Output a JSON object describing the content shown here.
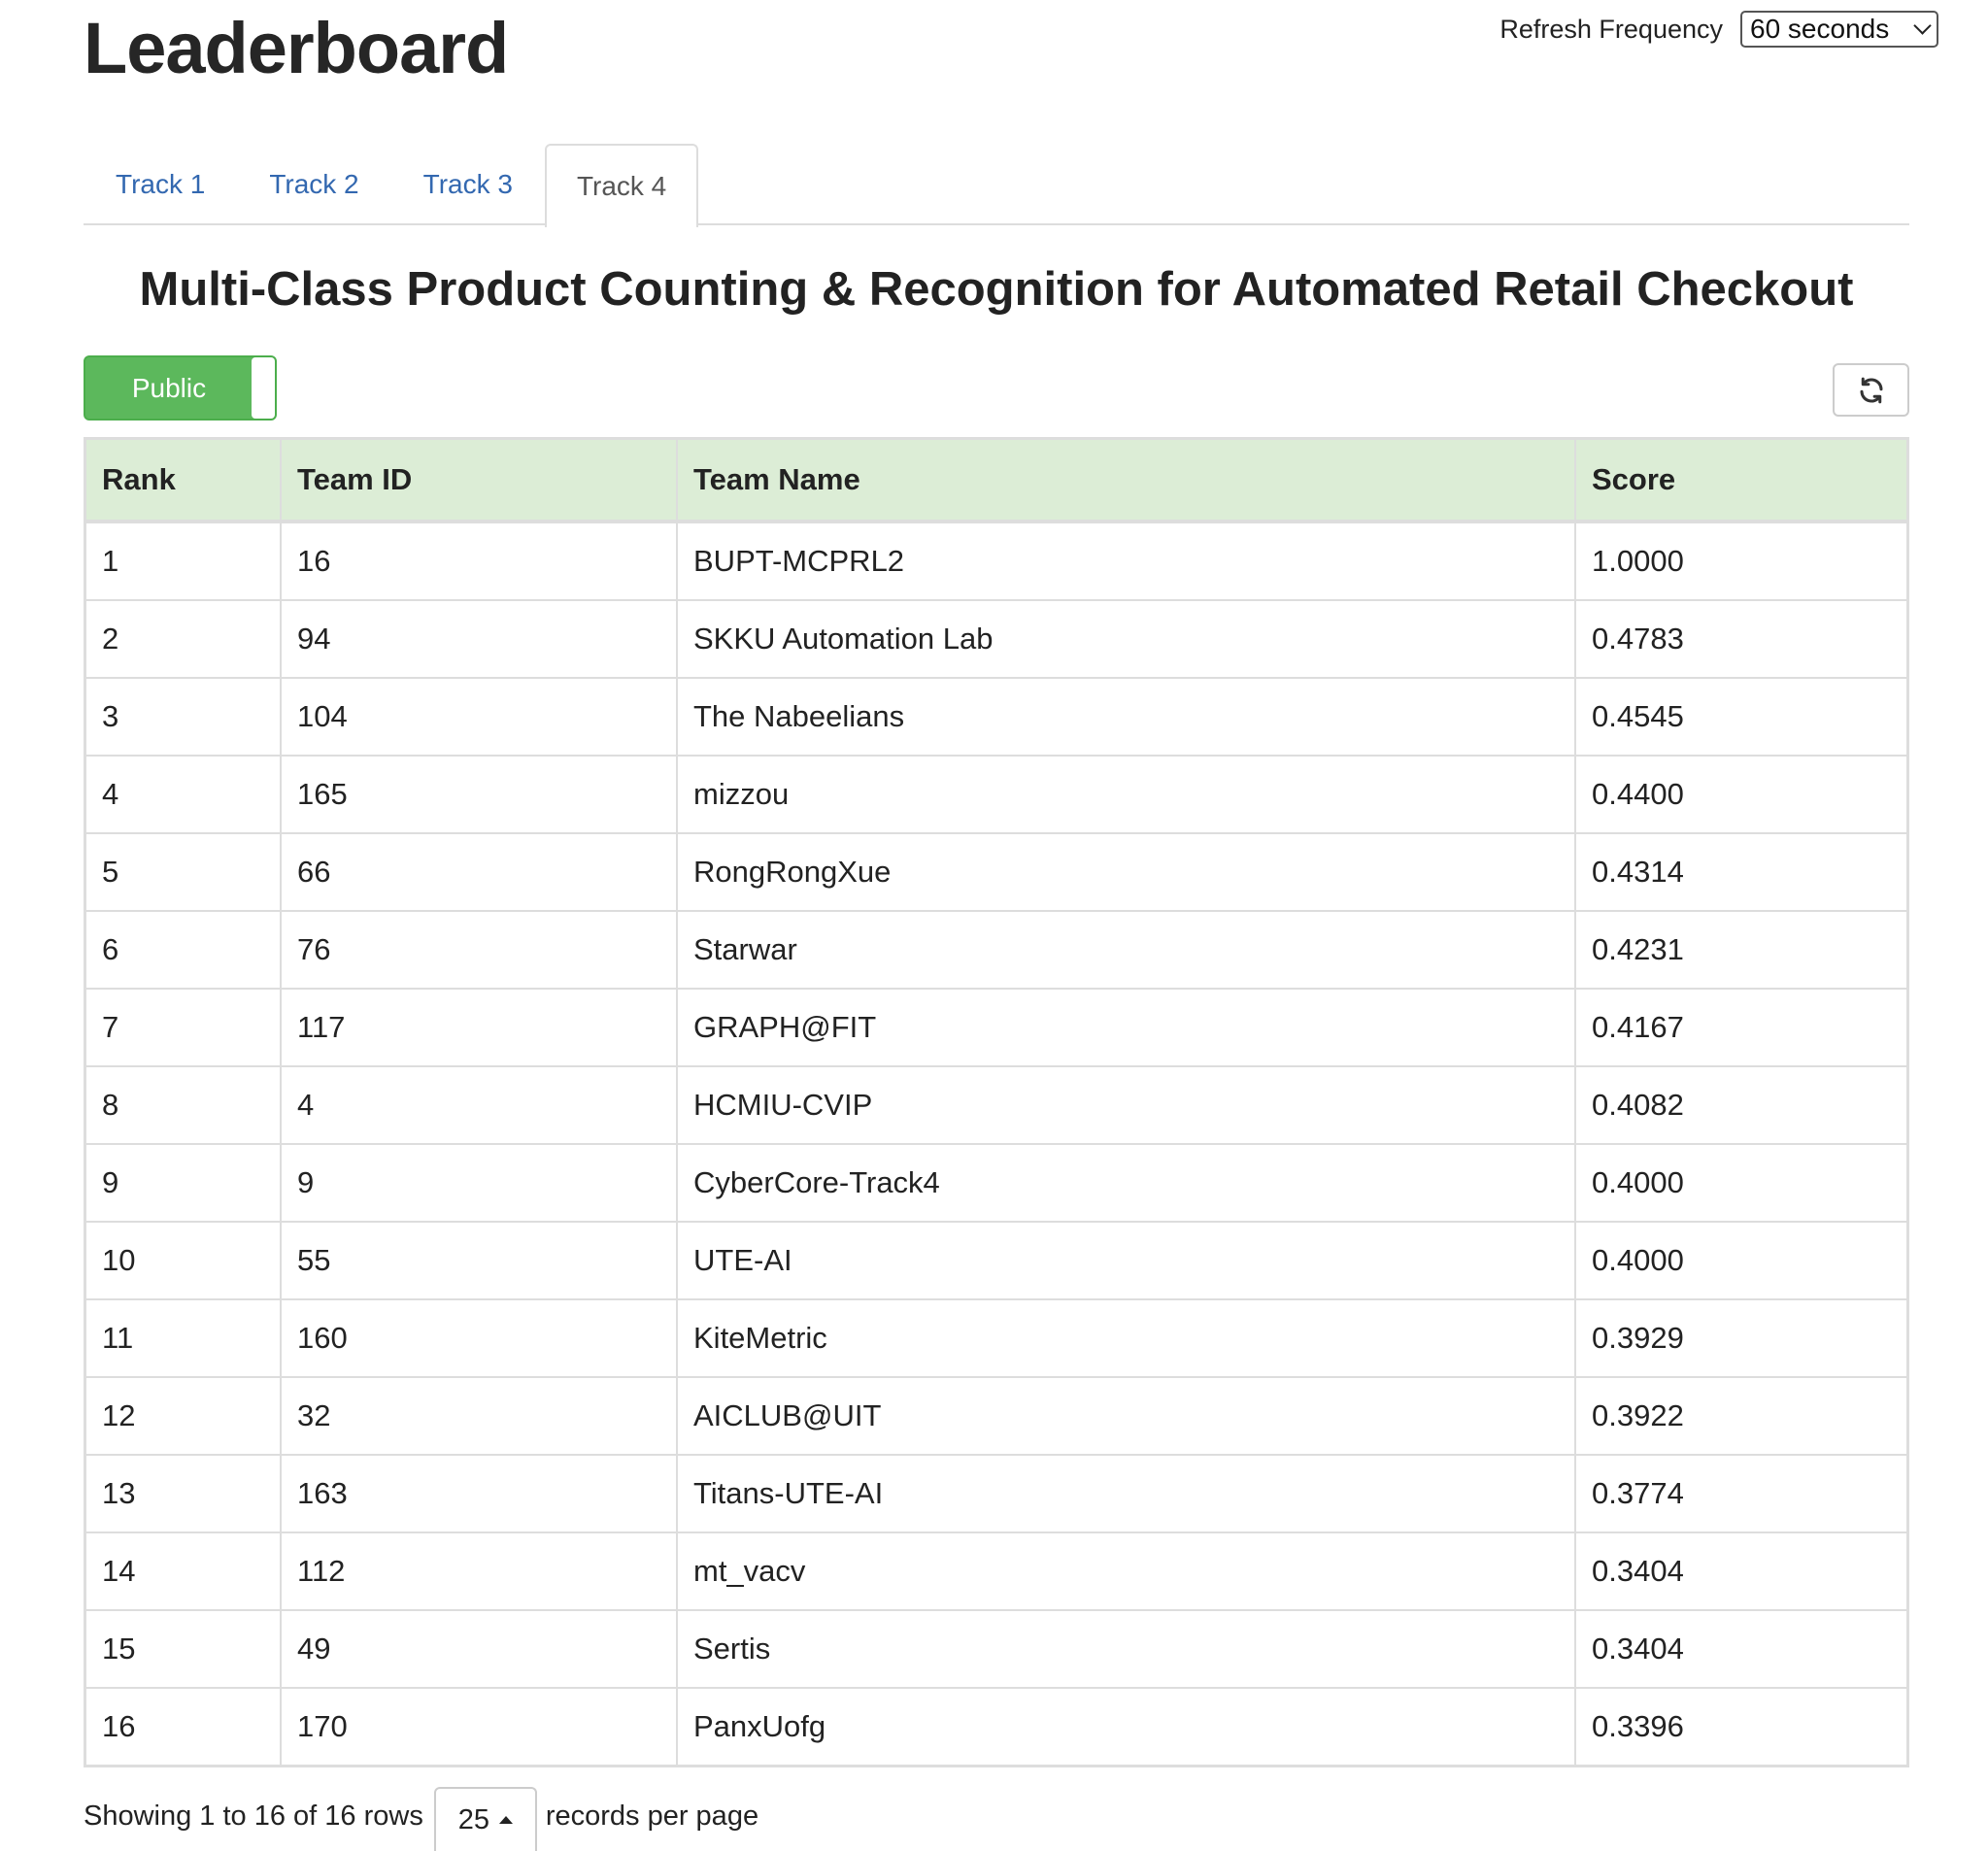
{
  "page": {
    "title": "Leaderboard",
    "subtitle": "Multi-Class Product Counting & Recognition for Automated Retail Checkout"
  },
  "refresh": {
    "label": "Refresh Frequency",
    "selected": "60 seconds"
  },
  "tabs": [
    {
      "label": "Track 1",
      "active": false
    },
    {
      "label": "Track 2",
      "active": false
    },
    {
      "label": "Track 3",
      "active": false
    },
    {
      "label": "Track 4",
      "active": true
    }
  ],
  "toggle": {
    "label": "Public",
    "state": "on",
    "color": "#5cb85c"
  },
  "refresh_button": {
    "icon": "refresh-icon"
  },
  "table": {
    "header_color": "#dcedd6",
    "columns": [
      "Rank",
      "Team ID",
      "Team Name",
      "Score"
    ],
    "rows": [
      [
        "1",
        "16",
        "BUPT-MCPRL2",
        "1.0000"
      ],
      [
        "2",
        "94",
        "SKKU Automation Lab",
        "0.4783"
      ],
      [
        "3",
        "104",
        "The Nabeelians",
        "0.4545"
      ],
      [
        "4",
        "165",
        "mizzou",
        "0.4400"
      ],
      [
        "5",
        "66",
        "RongRongXue",
        "0.4314"
      ],
      [
        "6",
        "76",
        "Starwar",
        "0.4231"
      ],
      [
        "7",
        "117",
        "GRAPH@FIT",
        "0.4167"
      ],
      [
        "8",
        "4",
        "HCMIU-CVIP",
        "0.4082"
      ],
      [
        "9",
        "9",
        "CyberCore-Track4",
        "0.4000"
      ],
      [
        "10",
        "55",
        "UTE-AI",
        "0.4000"
      ],
      [
        "11",
        "160",
        "KiteMetric",
        "0.3929"
      ],
      [
        "12",
        "32",
        "AICLUB@UIT",
        "0.3922"
      ],
      [
        "13",
        "163",
        "Titans-UTE-AI",
        "0.3774"
      ],
      [
        "14",
        "112",
        "mt_vacv",
        "0.3404"
      ],
      [
        "15",
        "49",
        "Sertis",
        "0.3404"
      ],
      [
        "16",
        "170",
        "PanxUofg",
        "0.3396"
      ]
    ]
  },
  "pagination": {
    "showing": "Showing 1 to 16 of 16 rows",
    "page_size": "25",
    "suffix": "records per page"
  }
}
